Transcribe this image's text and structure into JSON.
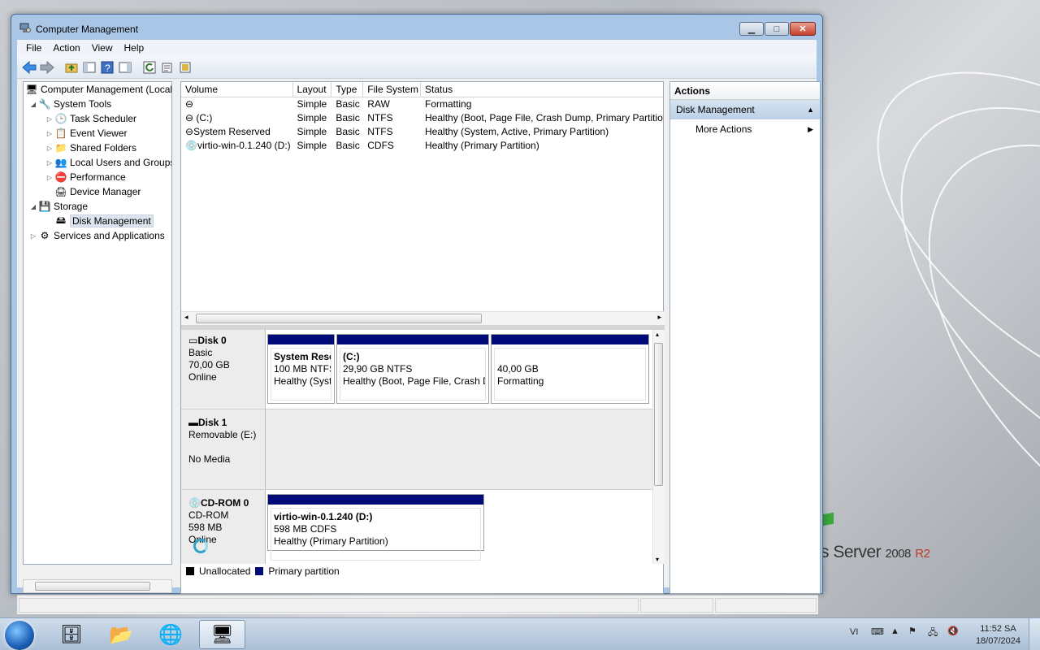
{
  "desktop": {
    "brand_text": "s Server",
    "brand_version": "2008",
    "brand_r2": "R2"
  },
  "window": {
    "title": "Computer Management",
    "controls": {
      "minimize": "▁",
      "maximize": "□",
      "close": "✕"
    }
  },
  "menu": [
    "File",
    "Action",
    "View",
    "Help"
  ],
  "tree": {
    "root": "Computer Management (Local",
    "system_tools": "System Tools",
    "task_scheduler": "Task Scheduler",
    "event_viewer": "Event Viewer",
    "shared_folders": "Shared Folders",
    "local_users": "Local Users and Groups",
    "performance": "Performance",
    "device_manager": "Device Manager",
    "storage": "Storage",
    "disk_management": "Disk Management",
    "services": "Services and Applications"
  },
  "volumes": {
    "columns": [
      "Volume",
      "Layout",
      "Type",
      "File System",
      "Status"
    ],
    "rows": [
      {
        "volume": "",
        "layout": "Simple",
        "type": "Basic",
        "fs": "RAW",
        "status": "Formatting"
      },
      {
        "volume": "(C:)",
        "layout": "Simple",
        "type": "Basic",
        "fs": "NTFS",
        "status": "Healthy (Boot, Page File, Crash Dump, Primary Partition"
      },
      {
        "volume": "System Reserved",
        "layout": "Simple",
        "type": "Basic",
        "fs": "NTFS",
        "status": "Healthy (System, Active, Primary Partition)"
      },
      {
        "volume": "virtio-win-0.1.240 (D:)",
        "layout": "Simple",
        "type": "Basic",
        "fs": "CDFS",
        "status": "Healthy (Primary Partition)"
      }
    ]
  },
  "disks": {
    "disk0": {
      "name": "Disk 0",
      "type": "Basic",
      "size": "70,00 GB",
      "state": "Online",
      "parts": [
        {
          "name": "System Rese",
          "size": "100 MB NTFS",
          "status": "Healthy (Syst"
        },
        {
          "name": "(C:)",
          "size": "29,90 GB NTFS",
          "status": "Healthy (Boot, Page File, Crash D"
        },
        {
          "name": "",
          "size": "40,00 GB",
          "status": "Formatting"
        }
      ]
    },
    "disk1": {
      "name": "Disk 1",
      "type": "Removable (E:)",
      "state": "No Media"
    },
    "cdrom0": {
      "name": "CD-ROM 0",
      "type": "CD-ROM",
      "size": "598 MB",
      "state": "Online",
      "part": {
        "name": "virtio-win-0.1.240  (D:)",
        "size": "598 MB CDFS",
        "status": "Healthy (Primary Partition)"
      }
    }
  },
  "legend": {
    "unallocated": "Unallocated",
    "primary": "Primary partition",
    "unallocated_color": "#000000",
    "primary_color": "#000a78"
  },
  "actions": {
    "header": "Actions",
    "section": "Disk Management",
    "more": "More Actions"
  },
  "taskbar": {
    "lang": "VI",
    "time": "11:52 SA",
    "date": "18/07/2024"
  }
}
